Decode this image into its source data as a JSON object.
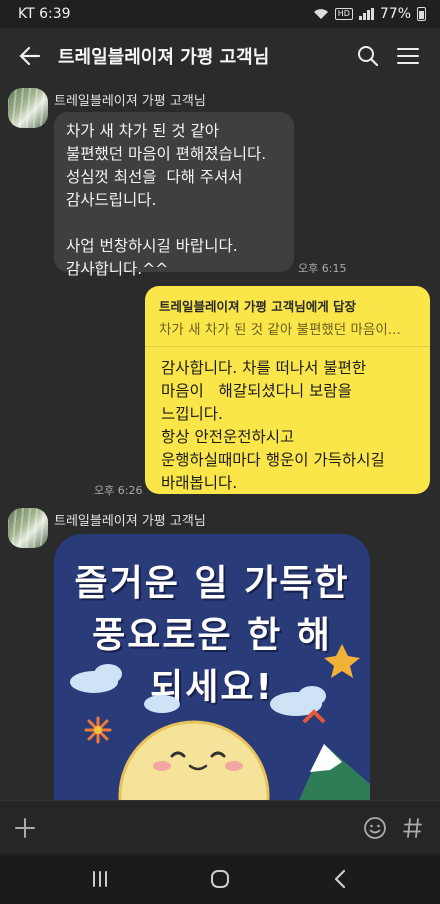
{
  "status_bar": {
    "carrier_time": "KT 6:39",
    "hd": "HD",
    "battery": "77%"
  },
  "header": {
    "title": "트레일블레이져 가평 고객님"
  },
  "messages": {
    "first": {
      "sender": "트레일블레이져 가평 고객님",
      "lines": [
        "차가 새 차가 된 것 같아",
        "불편했던 마음이 편해졌습니다.",
        "성심껏 최선을  다해 주셔서",
        "감사드립니다.",
        "",
        "사업 번창하시길 바랍니다.",
        "감사합니다.^^"
      ],
      "time": "오후 6:15"
    },
    "reply": {
      "reply_to": "트레일블레이져 가평 고객님에게 답장",
      "quote": "차가 새 차가 된 것 같아 불편했던 마음이...",
      "lines": [
        "감사합니다. 차를 떠나서 불편한",
        "마음이   해갈되셨다니 보람을",
        "느낍니다.",
        "항상 안전운전하시고",
        "운행하실때마다 행운이 가득하시길",
        "바래봅니다."
      ],
      "time": "오후 6:26"
    },
    "sticker": {
      "sender": "트레일블레이져 가평 고객님",
      "lines": [
        "즐거운 일 가득한",
        "풍요로운 한 해",
        "되세요!"
      ]
    }
  },
  "colors": {
    "background": "#2b2b2b",
    "incoming_bubble": "#3f3f3f",
    "outgoing_bubble": "#fbe64a",
    "sticker_bg": "#2a3b7a"
  },
  "icons": {
    "back": "back-arrow-icon",
    "search": "search-icon",
    "menu": "hamburger-menu-icon",
    "plus": "plus-icon",
    "emoji": "emoji-icon",
    "hash": "hash-icon",
    "recents": "recent-apps-icon",
    "home": "home-icon",
    "nav_back": "nav-back-icon"
  }
}
